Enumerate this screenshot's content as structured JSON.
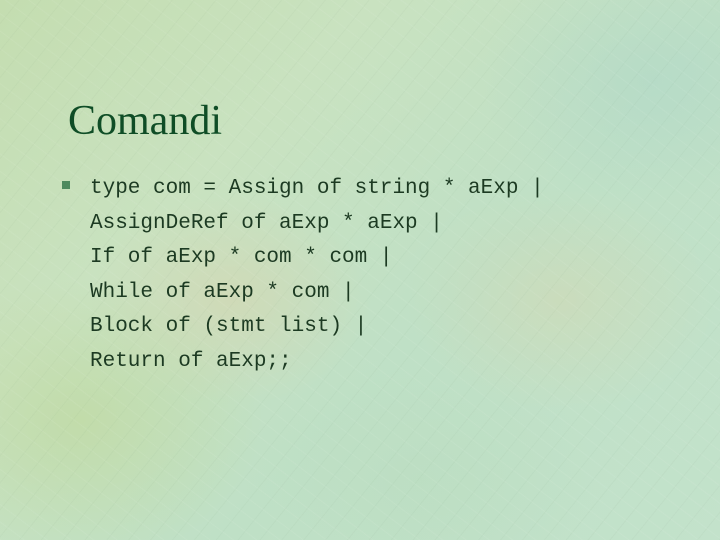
{
  "slide": {
    "title": "Comandi",
    "bullet": {
      "marker_icon": "square-bullet-icon",
      "lines": [
        "type com = Assign of string * aExp |",
        "AssignDeRef of aExp * aExp |",
        "If of aExp * com * com |",
        "While of aExp * com |",
        "Block of (stmt list) |",
        "Return of aExp;;"
      ]
    }
  },
  "colors": {
    "title": "#0f4d26",
    "body_text": "#1c3a22",
    "bullet": "#4e8a5e",
    "background": "#c6e0c0"
  }
}
